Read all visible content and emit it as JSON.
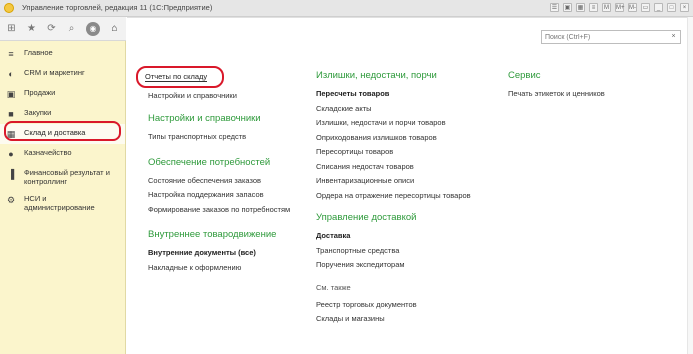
{
  "window": {
    "title": "Управление торговлей, редакция 11 (1С:Предприятие)",
    "title_icons": [
      "☰",
      "▣",
      "▦",
      "≡",
      "M",
      "M+",
      "M-",
      "▭",
      "_",
      "□",
      "×"
    ]
  },
  "toolbar": {
    "apps_icon": "⊞",
    "favorites_icon": "★",
    "history_icon": "⟳",
    "search_icon": "⌕",
    "notifications_icon": "◉",
    "home_icon": "⌂"
  },
  "sidebar": {
    "items": [
      {
        "label": "Главное",
        "icon": "≡"
      },
      {
        "label": "CRM и маркетинг",
        "icon": "◐"
      },
      {
        "label": "Продажи",
        "icon": "▣"
      },
      {
        "label": "Закупки",
        "icon": "■"
      },
      {
        "label": "Склад и доставка",
        "icon": "▦"
      },
      {
        "label": "Казначейство",
        "icon": "●"
      },
      {
        "label": "Финансовый результат и контроллинг",
        "icon": "▐"
      },
      {
        "label": "НСИ и администрирование",
        "icon": "⚙"
      }
    ]
  },
  "search": {
    "placeholder": "Поиск (Ctrl+F)",
    "clear": "×"
  },
  "reports_button": "Отчеты по складу",
  "col1": {
    "top_link": "Настройки и справочники",
    "sections": [
      {
        "title": "Настройки и справочники",
        "links": [
          "Типы транспортных средств"
        ]
      },
      {
        "title": "Обеспечение потребностей",
        "links": [
          "Состояние обеспечения заказов",
          "Настройка поддержания запасов",
          "Формирование заказов по потребностям"
        ]
      },
      {
        "title": "Внутреннее товародвижение",
        "links": [
          "Внутренние документы (все)",
          "Накладные к оформлению"
        ]
      }
    ]
  },
  "col2": {
    "sections": [
      {
        "title": "Излишки, недостачи, порчи",
        "links": [
          "Пересчеты товаров",
          "Складские акты",
          "Излишки, недостачи и порчи товаров",
          "Оприходования излишков товаров",
          "Пересортицы товаров",
          "Списания недостач товаров",
          "Инвентаризационные описи",
          "Ордера на отражение пересортицы товаров"
        ]
      },
      {
        "title": "Управление доставкой",
        "links": [
          "Доставка",
          "Транспортные средства",
          "Поручения экспедиторам"
        ]
      }
    ],
    "see_also": {
      "title": "См. также",
      "links": [
        "Реестр торговых документов",
        "Склады и магазины"
      ]
    }
  },
  "col3": {
    "title": "Сервис",
    "links": [
      "Печать этикеток и ценников"
    ]
  },
  "colors": {
    "section_title": "#2e9a3b",
    "sidebar_bg": "#fbf5cc",
    "highlight": "#d9182a"
  }
}
